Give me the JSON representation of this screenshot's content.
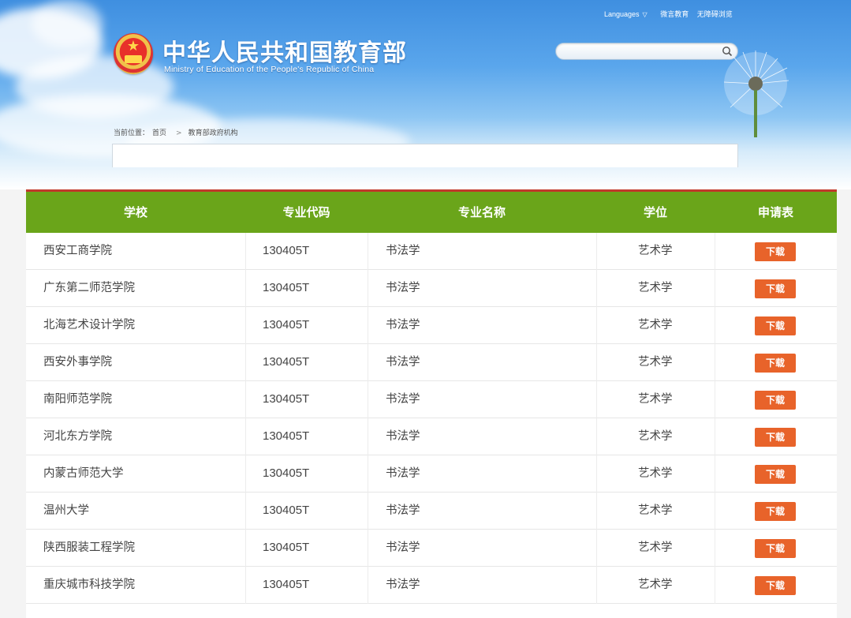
{
  "header": {
    "title_cn": "中华人民共和国教育部",
    "title_en": "Ministry of Education of the People's Republic of China",
    "links": [
      "Languages",
      "微言教育",
      "无障碍浏览"
    ],
    "search_placeholder": ""
  },
  "breadcrumb": {
    "prefix": "当前位置：",
    "home": "首页",
    "current": "教育部政府机构"
  },
  "table": {
    "columns": [
      "学校",
      "专业代码",
      "专业名称",
      "学位",
      "申请表"
    ],
    "rows": [
      {
        "school": "西安工商学院",
        "code": "130405T",
        "major": "书法学",
        "degree": "艺术学",
        "action": "下载"
      },
      {
        "school": "广东第二师范学院",
        "code": "130405T",
        "major": "书法学",
        "degree": "艺术学",
        "action": "下载"
      },
      {
        "school": "北海艺术设计学院",
        "code": "130405T",
        "major": "书法学",
        "degree": "艺术学",
        "action": "下载"
      },
      {
        "school": "西安外事学院",
        "code": "130405T",
        "major": "书法学",
        "degree": "艺术学",
        "action": "下载"
      },
      {
        "school": "南阳师范学院",
        "code": "130405T",
        "major": "书法学",
        "degree": "艺术学",
        "action": "下载"
      },
      {
        "school": "河北东方学院",
        "code": "130405T",
        "major": "书法学",
        "degree": "艺术学",
        "action": "下载"
      },
      {
        "school": "内蒙古师范大学",
        "code": "130405T",
        "major": "书法学",
        "degree": "艺术学",
        "action": "下载"
      },
      {
        "school": "温州大学",
        "code": "130405T",
        "major": "书法学",
        "degree": "艺术学",
        "action": "下载"
      },
      {
        "school": "陕西服装工程学院",
        "code": "130405T",
        "major": "书法学",
        "degree": "艺术学",
        "action": "下载"
      },
      {
        "school": "重庆城市科技学院",
        "code": "130405T",
        "major": "书法学",
        "degree": "艺术学",
        "action": "下载"
      }
    ]
  },
  "colors": {
    "header_green": "#6aa51a",
    "header_top_border": "#c0392b",
    "download_button": "#e8632a",
    "sky_blue": "#3f8fe0"
  }
}
